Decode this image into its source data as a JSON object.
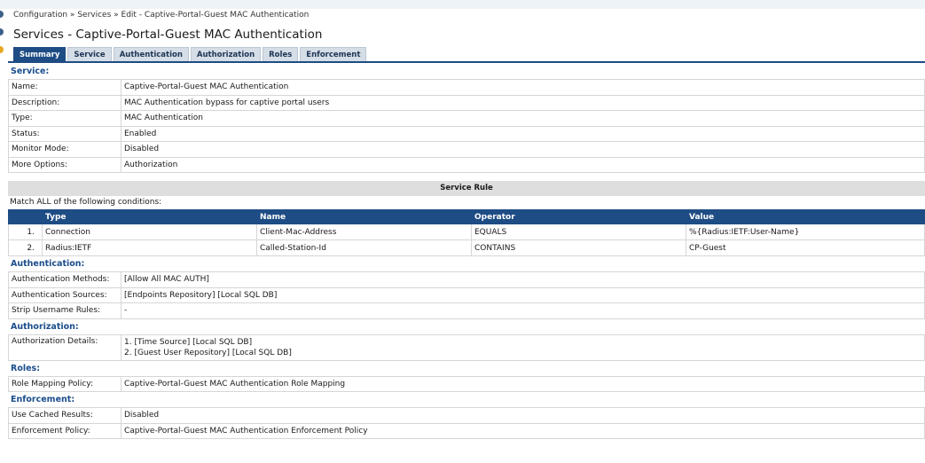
{
  "breadcrumb": {
    "part1": "Configuration",
    "part2": "Services",
    "part3": "Edit - Captive-Portal-Guest MAC Authentication",
    "sep": "»"
  },
  "page_title": "Services - Captive-Portal-Guest MAC Authentication",
  "tabs": [
    {
      "label": "Summary",
      "active": true
    },
    {
      "label": "Service"
    },
    {
      "label": "Authentication"
    },
    {
      "label": "Authorization"
    },
    {
      "label": "Roles"
    },
    {
      "label": "Enforcement"
    }
  ],
  "service": {
    "heading": "Service:",
    "rows": [
      {
        "label": "Name:",
        "value": "Captive-Portal-Guest MAC Authentication"
      },
      {
        "label": "Description:",
        "value": "MAC Authentication bypass for captive portal users"
      },
      {
        "label": "Type:",
        "value": "MAC Authentication"
      },
      {
        "label": "Status:",
        "value": "Enabled"
      },
      {
        "label": "Monitor Mode:",
        "value": "Disabled"
      },
      {
        "label": "More Options:",
        "value": "Authorization"
      }
    ]
  },
  "service_rule": {
    "title": "Service Rule",
    "match_text": "Match ALL of the following conditions:",
    "columns": [
      "Type",
      "Name",
      "Operator",
      "Value"
    ],
    "rows": [
      {
        "num": "1.",
        "type": "Connection",
        "name": "Client-Mac-Address",
        "operator": "EQUALS",
        "value": "%{Radius:IETF:User-Name}"
      },
      {
        "num": "2.",
        "type": "Radius:IETF",
        "name": "Called-Station-Id",
        "operator": "CONTAINS",
        "value": "CP-Guest"
      }
    ]
  },
  "authentication": {
    "heading": "Authentication:",
    "rows": [
      {
        "label": "Authentication Methods:",
        "value": "[Allow All MAC AUTH]"
      },
      {
        "label": "Authentication Sources:",
        "value": "[Endpoints Repository] [Local SQL DB]"
      },
      {
        "label": "Strip Username Rules:",
        "value": "-"
      }
    ]
  },
  "authorization": {
    "heading": "Authorization:",
    "label": "Authorization Details:",
    "line1": "1. [Time Source] [Local SQL DB]",
    "line2": "2. [Guest User Repository] [Local SQL DB]"
  },
  "roles": {
    "heading": "Roles:",
    "rows": [
      {
        "label": "Role Mapping Policy:",
        "value": "Captive-Portal-Guest MAC Authentication Role Mapping"
      }
    ]
  },
  "enforcement": {
    "heading": "Enforcement:",
    "rows": [
      {
        "label": "Use Cached Results:",
        "value": "Disabled"
      },
      {
        "label": "Enforcement Policy:",
        "value": "Captive-Portal-Guest MAC Authentication Enforcement Policy"
      }
    ]
  },
  "colors": {
    "accent": "#1e4c84",
    "section_heading": "#1a4d8c",
    "rule_bar": "#dedede"
  }
}
